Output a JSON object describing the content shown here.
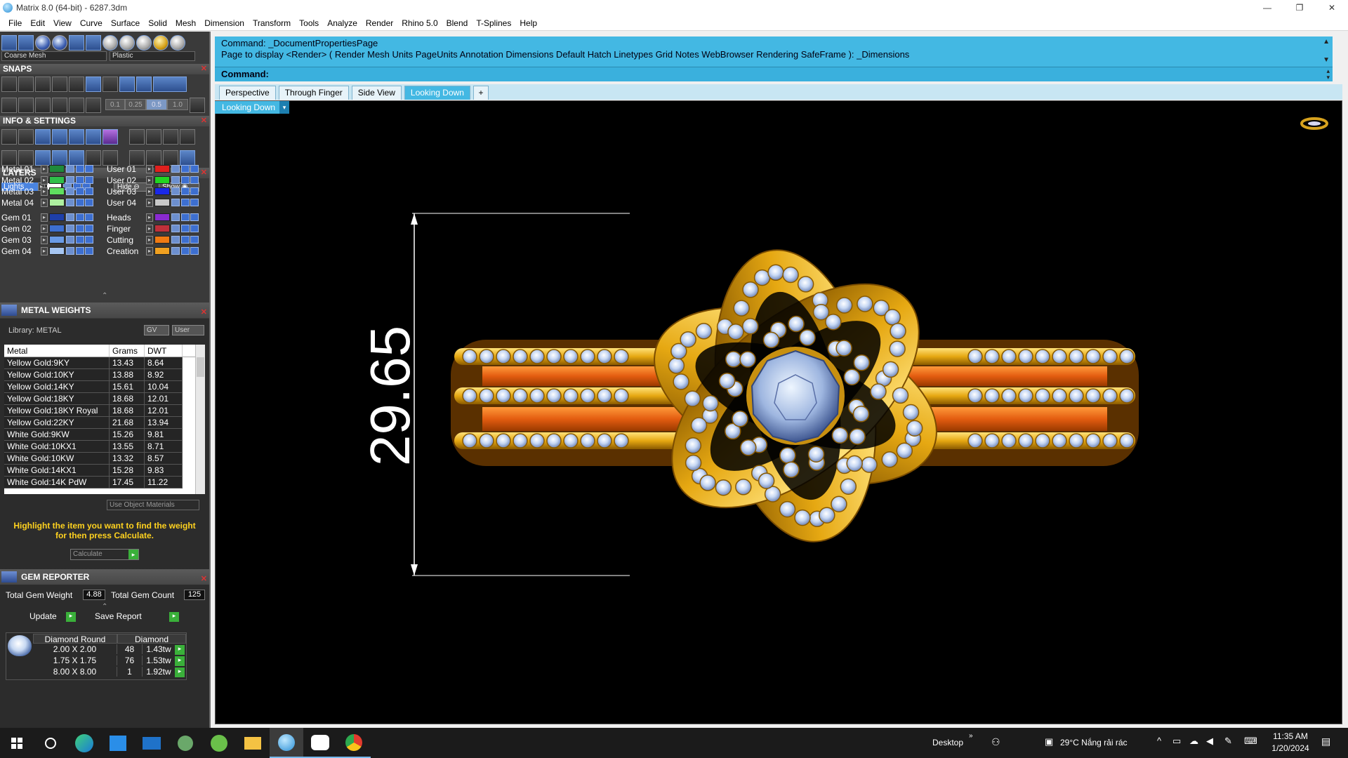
{
  "window": {
    "title": "Matrix 8.0 (64-bit) - 6287.3dm",
    "minimize": "—",
    "restore": "❐",
    "close": "✕"
  },
  "menu": [
    "File",
    "Edit",
    "View",
    "Curve",
    "Surface",
    "Solid",
    "Mesh",
    "Dimension",
    "Transform",
    "Tools",
    "Analyze",
    "Render",
    "Rhino 5.0",
    "Blend",
    "T-Splines",
    "Help"
  ],
  "toolbar": {
    "mesh_select": "Coarse Mesh",
    "material_select": "Plastic"
  },
  "snaps": {
    "header": "SNAPS",
    "values": [
      "0.1",
      "0.25",
      "0.5",
      "1.0"
    ]
  },
  "info_settings": {
    "header": "INFO & SETTINGS"
  },
  "layers": {
    "header": "LAYERS",
    "lights_label": "Lights",
    "hide_label": "Hide",
    "show_label": "Show",
    "left": [
      {
        "name": "Metal 01",
        "color": "#1f8a3a"
      },
      {
        "name": "Metal 02",
        "color": "#2fbf4a"
      },
      {
        "name": "Metal 03",
        "color": "#5fe05f"
      },
      {
        "name": "Metal 04",
        "color": "#aef0a0"
      },
      {
        "name": "Gem 01",
        "color": "#1e3fa8"
      },
      {
        "name": "Gem 02",
        "color": "#3d6fd0"
      },
      {
        "name": "Gem 03",
        "color": "#6a9be6"
      },
      {
        "name": "Gem 04",
        "color": "#a6c6f2"
      }
    ],
    "right": [
      {
        "name": "User 01",
        "color": "#e0201e"
      },
      {
        "name": "User 02",
        "color": "#22d422"
      },
      {
        "name": "User 03",
        "color": "#1a28e8"
      },
      {
        "name": "User 04",
        "color": "#c8c8c8"
      },
      {
        "name": "Heads",
        "color": "#8a2bd0"
      },
      {
        "name": "Finger",
        "color": "#c0303a"
      },
      {
        "name": "Cutting",
        "color": "#f07a12"
      },
      {
        "name": "Creation",
        "color": "#f0a020"
      }
    ]
  },
  "metal_weights": {
    "header": "METAL WEIGHTS",
    "library_label": "Library: METAL",
    "gv_label": "GV",
    "user_label": "User",
    "columns": [
      "Metal",
      "Grams",
      "DWT"
    ],
    "rows": [
      [
        "Yellow Gold:9KY",
        "13.43",
        "8.64"
      ],
      [
        "Yellow Gold:10KY",
        "13.88",
        "8.92"
      ],
      [
        "Yellow Gold:14KY",
        "15.61",
        "10.04"
      ],
      [
        "Yellow Gold:18KY",
        "18.68",
        "12.01"
      ],
      [
        "Yellow Gold:18KY Royal",
        "18.68",
        "12.01"
      ],
      [
        "Yellow Gold:22KY",
        "21.68",
        "13.94"
      ],
      [
        "White Gold:9KW",
        "15.26",
        "9.81"
      ],
      [
        "White Gold:10KX1",
        "13.55",
        "8.71"
      ],
      [
        "White Gold:10KW",
        "13.32",
        "8.57"
      ],
      [
        "White Gold:14KX1",
        "15.28",
        "9.83"
      ],
      [
        "White Gold:14K PdW",
        "17.45",
        "11.22"
      ]
    ],
    "use_object_materials": "Use Object Materials",
    "hint": "Highlight the item you want to find the weight for then press Calculate.",
    "calculate_label": "Calculate"
  },
  "gem_reporter": {
    "header": "GEM REPORTER",
    "total_weight_label": "Total Gem Weight",
    "total_weight": "4.88",
    "total_count_label": "Total Gem Count",
    "total_count": "125",
    "update_label": "Update",
    "save_report_label": "Save Report",
    "col_shape": "Diamond Round",
    "col_type": "Diamond",
    "rows": [
      {
        "size": "2.00 X 2.00",
        "count": "48",
        "weight": "1.43tw"
      },
      {
        "size": "1.75 X 1.75",
        "count": "76",
        "weight": "1.53tw"
      },
      {
        "size": "8.00 X 8.00",
        "count": "1",
        "weight": "1.92tw"
      }
    ]
  },
  "command": {
    "line1": "Command: _DocumentPropertiesPage",
    "line2": "Page to display <Render> ( Render  Mesh  Units  PageUnits  Annotation  Dimensions  Default  Hatch  Linetypes  Grid  Notes  WebBrowser  Rendering  SafeFrame ): _Dimensions",
    "prompt_label": "Command:"
  },
  "view_tabs": [
    "Perspective",
    "Through Finger",
    "Side View",
    "Looking Down"
  ],
  "active_view": "Looking Down",
  "viewport": {
    "dimension_value": "29.65"
  },
  "taskbar": {
    "desktop_label": "Desktop",
    "weather": "29°C  Nắng rải rác",
    "time": "11:35 AM",
    "date": "1/20/2024"
  }
}
